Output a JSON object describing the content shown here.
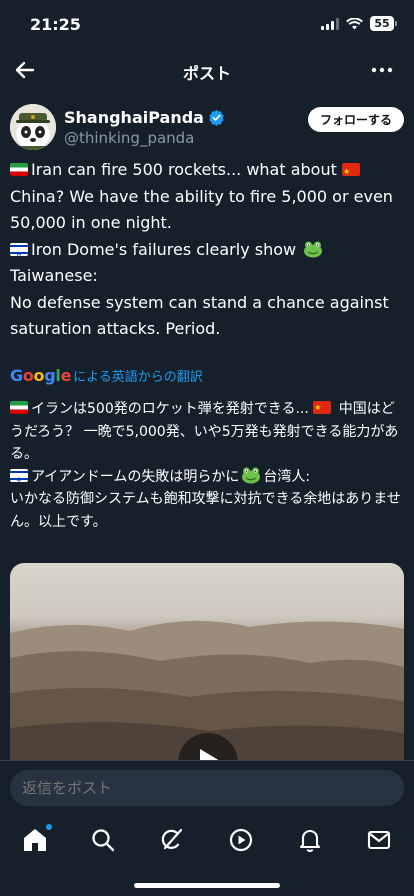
{
  "status_bar": {
    "time": "21:25",
    "battery": "55"
  },
  "nav": {
    "title": "ポスト"
  },
  "author": {
    "name": "ShanghaiPanda",
    "handle": "@thinking_panda",
    "follow_label": "フォローする"
  },
  "tweet_en": {
    "p1_a": "Iran can fire 500 rockets... what about",
    "p1_b": "China? We have the ability to fire 5,000 or even 50,000 in one night.",
    "p2_a": "Iron Dome's failures clearly show",
    "p2_b": "Taiwanese:",
    "p3": "No defense system can stand a chance against saturation attacks. Period."
  },
  "translation": {
    "google": "Google",
    "label": "による英語からの翻訳"
  },
  "tweet_jp": {
    "p1_a": "イランは500発のロケット弾を発射できる...",
    "p1_b": "中国はどうだろう？ 一晩で5,000発、いや5万発も発射できる能力がある。",
    "p2_a": "アイアンドームの失敗は明らかに",
    "p2_b": "台湾人:",
    "p3": "いかなる防御システムも飽和攻撃に対抗できる余地はありません。以上です。"
  },
  "reply": {
    "placeholder": "返信をポスト"
  },
  "colors": {
    "background": "#15202b",
    "accent": "#1d9bf0",
    "muted": "#8b98a5"
  },
  "icons": [
    "back-arrow-icon",
    "more-icon",
    "verified-icon",
    "play-icon",
    "home-icon",
    "search-icon",
    "grok-icon",
    "video-icon",
    "bell-icon",
    "mail-icon"
  ]
}
